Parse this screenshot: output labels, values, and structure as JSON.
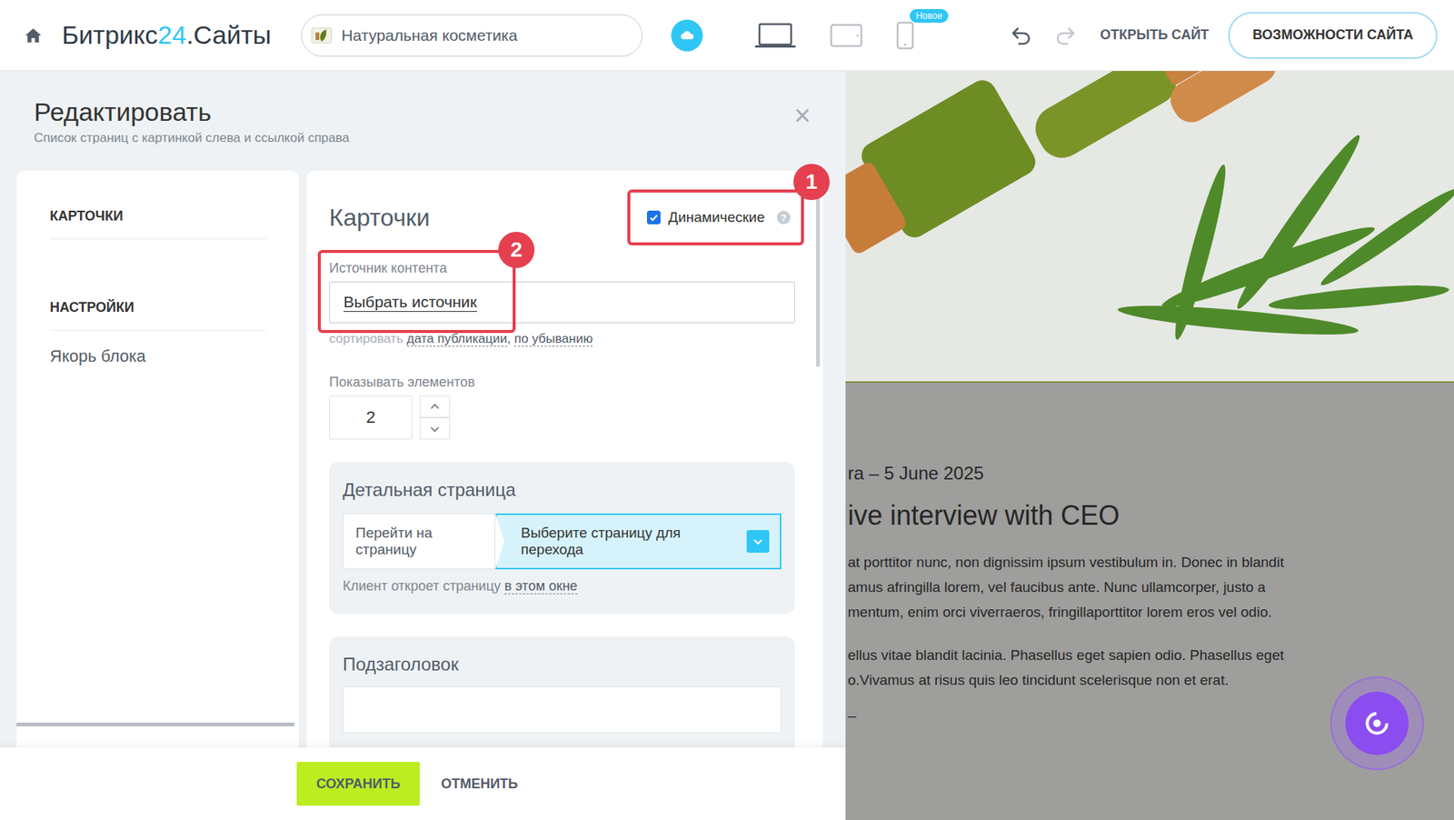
{
  "topbar": {
    "logo": [
      "Битрикс",
      "24",
      ".Сайты"
    ],
    "site": "Натуральная косметика",
    "devices": [
      {
        "kind": "desktop",
        "selected": true
      },
      {
        "kind": "tablet",
        "selected": false
      },
      {
        "kind": "mobile",
        "selected": false,
        "badge": "Новое"
      }
    ],
    "history": [
      {
        "kind": "undo",
        "disabled": false
      },
      {
        "kind": "redo",
        "disabled": true
      }
    ],
    "open_site": "ОТКРЫТЬ САЙТ",
    "features_button": "ВОЗМОЖНОСТИ САЙТА"
  },
  "panel": {
    "title": "Редактировать",
    "subtitle": "Список страниц с картинкой слева и ссылкой справа",
    "close": "×"
  },
  "nav": [
    {
      "label": "КАРТОЧКИ",
      "kind": "section"
    },
    {
      "label": "НАСТРОЙКИ",
      "kind": "section"
    },
    {
      "label": "Якорь блока",
      "kind": "item"
    }
  ],
  "form": {
    "heading": "Карточки",
    "dynamic": {
      "label": "Динамические",
      "checked": true,
      "help": "?"
    },
    "source": {
      "label": "Источник контента",
      "value": "Выбрать источник"
    },
    "sort": {
      "prefix": "сортировать",
      "field": "дата публикации",
      "sep": ",",
      "order": "по убыванию"
    },
    "count": {
      "label": "Показывать элементов",
      "value": "2"
    },
    "detail": {
      "title": "Детальная страница",
      "action": "Перейти на страницу",
      "target": "Выберите страницу для перехода",
      "hint": "Клиент откроет страницу",
      "window": "в этом окне"
    },
    "subheading": "Подзаголовок"
  },
  "annotations": [
    {
      "number": "1"
    },
    {
      "number": "2"
    }
  ],
  "footer": {
    "save": "СОХРАНИТЬ",
    "cancel": "ОТМЕНИТЬ"
  },
  "preview": {
    "meta": "ra  –  5 June 2025",
    "title": "ive interview with CEO",
    "paragraphs": [
      [
        "at porttitor nunc, non dignissim ipsum vestibulum in. Donec in blandit",
        "amus afringilla lorem, vel faucibus ante. Nunc ullamcorper, justo a",
        "mentum, enim orci viverraeros, fringillaporttitor lorem eros vel odio."
      ],
      [
        "ellus vitae blandit lacinia. Phasellus eget sapien odio. Phasellus eget",
        "o.Vivamus at risus quis leo tincidunt scelerisque non et erat."
      ]
    ],
    "dash": "–"
  }
}
